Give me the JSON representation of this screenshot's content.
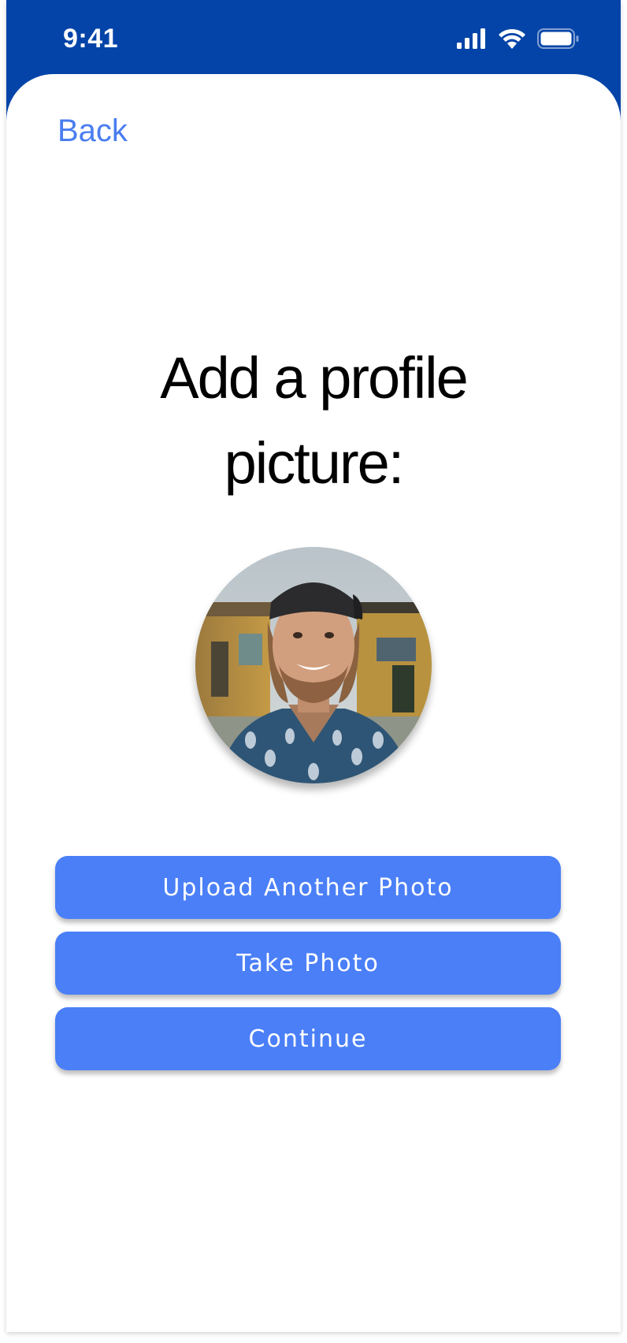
{
  "status_bar": {
    "time": "9:41",
    "icons": [
      "signal-icon",
      "wifi-icon",
      "battery-icon"
    ]
  },
  "nav": {
    "back_label": "Back"
  },
  "main": {
    "title_line1": "Add a profile",
    "title_line2": "picture:",
    "avatar": "profile-photo"
  },
  "actions": {
    "upload_label": "Upload Another Photo",
    "take_photo_label": "Take Photo",
    "continue_label": "Continue"
  },
  "colors": {
    "header_blue": "#0444A8",
    "accent_blue": "#4A7FF7",
    "link_blue": "#4A7DF0",
    "background": "#FFFFFF"
  }
}
